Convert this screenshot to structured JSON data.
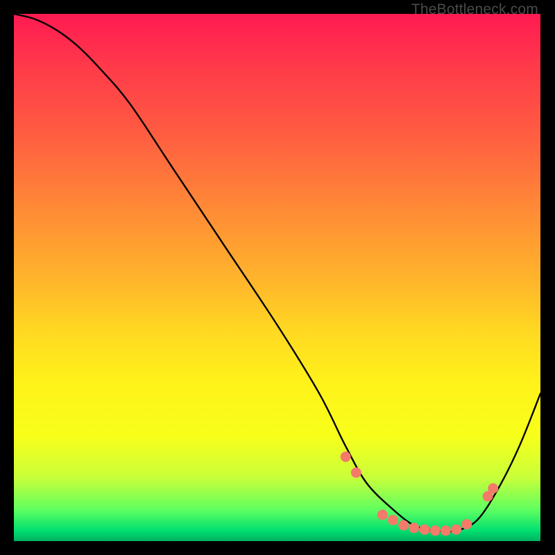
{
  "watermark": "TheBottleneck.com",
  "chart_data": {
    "type": "line",
    "title": "",
    "xlabel": "",
    "ylabel": "",
    "xlim": [
      0,
      100
    ],
    "ylim": [
      0,
      100
    ],
    "curve": {
      "comment": "Approximate curve drawn over the gradient. y is percent from bottom (0 = bottom, 100 = top).",
      "x": [
        0,
        4,
        8,
        12,
        16,
        22,
        30,
        40,
        50,
        58,
        63,
        67,
        72,
        76,
        80,
        84,
        88,
        92,
        96,
        100
      ],
      "y": [
        100,
        99,
        97,
        94,
        90,
        83,
        71,
        56,
        41,
        28,
        18,
        11,
        6,
        3,
        2,
        2,
        4,
        10,
        18,
        28
      ]
    },
    "markers": {
      "comment": "Salmon dots near the trough region along the curve.",
      "color": "#f47a6a",
      "x": [
        63,
        65,
        70,
        72,
        74,
        76,
        78,
        80,
        82,
        84,
        86,
        90,
        91
      ],
      "y": [
        16,
        13,
        5,
        4,
        3,
        2.5,
        2.2,
        2,
        2,
        2.2,
        3.2,
        8.5,
        10
      ]
    },
    "gradient_stops": [
      {
        "pos": 0,
        "color": "#ff1a52"
      },
      {
        "pos": 10,
        "color": "#ff3a4a"
      },
      {
        "pos": 22,
        "color": "#ff5a42"
      },
      {
        "pos": 32,
        "color": "#ff7a3a"
      },
      {
        "pos": 42,
        "color": "#ff9a32"
      },
      {
        "pos": 52,
        "color": "#ffba2a"
      },
      {
        "pos": 60,
        "color": "#ffd822"
      },
      {
        "pos": 70,
        "color": "#fff21a"
      },
      {
        "pos": 80,
        "color": "#f8ff1a"
      },
      {
        "pos": 88,
        "color": "#c8ff3a"
      },
      {
        "pos": 94,
        "color": "#60ff60"
      },
      {
        "pos": 98,
        "color": "#00e070"
      },
      {
        "pos": 100,
        "color": "#00b060"
      }
    ]
  }
}
